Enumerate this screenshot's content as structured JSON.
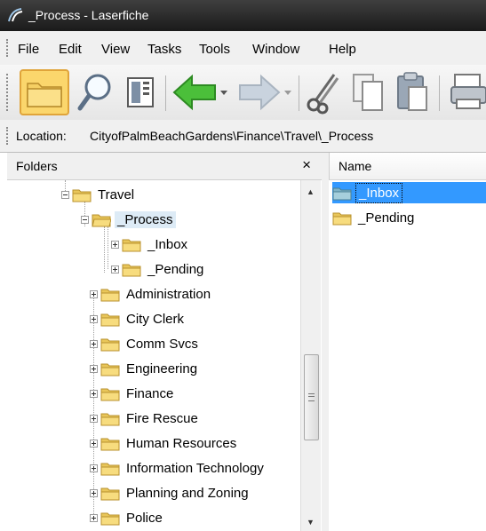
{
  "window": {
    "title": "_Process - Laserfiche",
    "app_icon": "laserfiche-logo-icon"
  },
  "menu": {
    "items": [
      "File",
      "Edit",
      "View",
      "Tasks",
      "Tools",
      "Window",
      "Help"
    ]
  },
  "toolbar": {
    "buttons": [
      "folder-icon",
      "search-icon",
      "document-view-icon",
      "back-arrow-icon",
      "forward-arrow-icon",
      "cut-icon",
      "copy-icon",
      "paste-icon",
      "print-icon"
    ]
  },
  "location": {
    "label": "Location:",
    "path": "CityofPalmBeachGardens\\Finance\\Travel\\_Process"
  },
  "folders_pane": {
    "header": "Folders",
    "close": "×",
    "tree": [
      {
        "label": "Travel",
        "state": "expanded"
      },
      {
        "label": "_Process",
        "state": "expanded",
        "selected": true
      },
      {
        "label": "_Inbox",
        "state": "collapsed"
      },
      {
        "label": "_Pending",
        "state": "collapsed"
      },
      {
        "label": "Administration",
        "state": "collapsed"
      },
      {
        "label": "City Clerk",
        "state": "collapsed"
      },
      {
        "label": "Comm Svcs",
        "state": "collapsed"
      },
      {
        "label": "Engineering",
        "state": "collapsed"
      },
      {
        "label": "Finance",
        "state": "collapsed"
      },
      {
        "label": "Fire Rescue",
        "state": "collapsed"
      },
      {
        "label": "Human Resources",
        "state": "collapsed"
      },
      {
        "label": "Information Technology",
        "state": "collapsed"
      },
      {
        "label": "Planning and Zoning",
        "state": "collapsed"
      },
      {
        "label": "Police",
        "state": "collapsed"
      }
    ]
  },
  "contents_pane": {
    "column_header": "Name",
    "items": [
      {
        "name": "_Inbox",
        "selected": true
      },
      {
        "name": "_Pending",
        "selected": false
      }
    ]
  },
  "colors": {
    "selection": "#3399ff",
    "folder_yellow": "#f5d46b"
  }
}
